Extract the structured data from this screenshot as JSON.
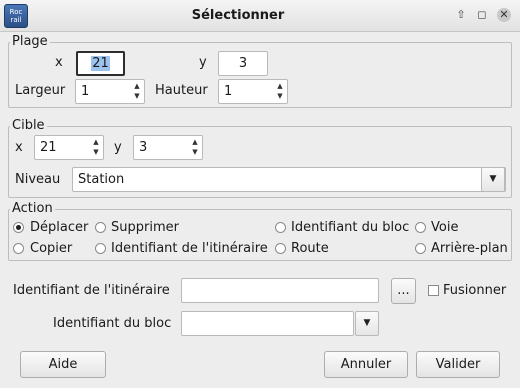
{
  "window": {
    "title": "Sélectionner",
    "app_icon_line1": "Roc",
    "app_icon_line2": "rail",
    "controls": [
      "pin-icon",
      "restore-icon",
      "close-icon"
    ]
  },
  "plage": {
    "legend": "Plage",
    "x_label": "x",
    "x_value": "21",
    "y_label": "y",
    "y_value": "3",
    "width_label": "Largeur",
    "width_value": "1",
    "height_label": "Hauteur",
    "height_value": "1"
  },
  "cible": {
    "legend": "Cible",
    "x_label": "x",
    "x_value": "21",
    "y_label": "y",
    "y_value": "3",
    "level_label": "Niveau",
    "level_value": "Station"
  },
  "action": {
    "legend": "Action",
    "options": [
      {
        "label": "Déplacer",
        "selected": true
      },
      {
        "label": "Supprimer",
        "selected": false
      },
      {
        "label": "Identifiant du bloc",
        "selected": false
      },
      {
        "label": "Voie",
        "selected": false
      },
      {
        "label": "Copier",
        "selected": false
      },
      {
        "label": "Identifiant de l'itinéraire",
        "selected": false
      },
      {
        "label": "Route",
        "selected": false
      },
      {
        "label": "Arrière-plan",
        "selected": false
      }
    ]
  },
  "route_id": {
    "label": "Identifiant de l'itinéraire",
    "value": "",
    "browse_label": "...",
    "merge_label": "Fusionner",
    "merge_checked": false
  },
  "block_id": {
    "label": "Identifiant du bloc",
    "value": ""
  },
  "buttons": {
    "help": "Aide",
    "cancel": "Annuler",
    "ok": "Valider"
  }
}
